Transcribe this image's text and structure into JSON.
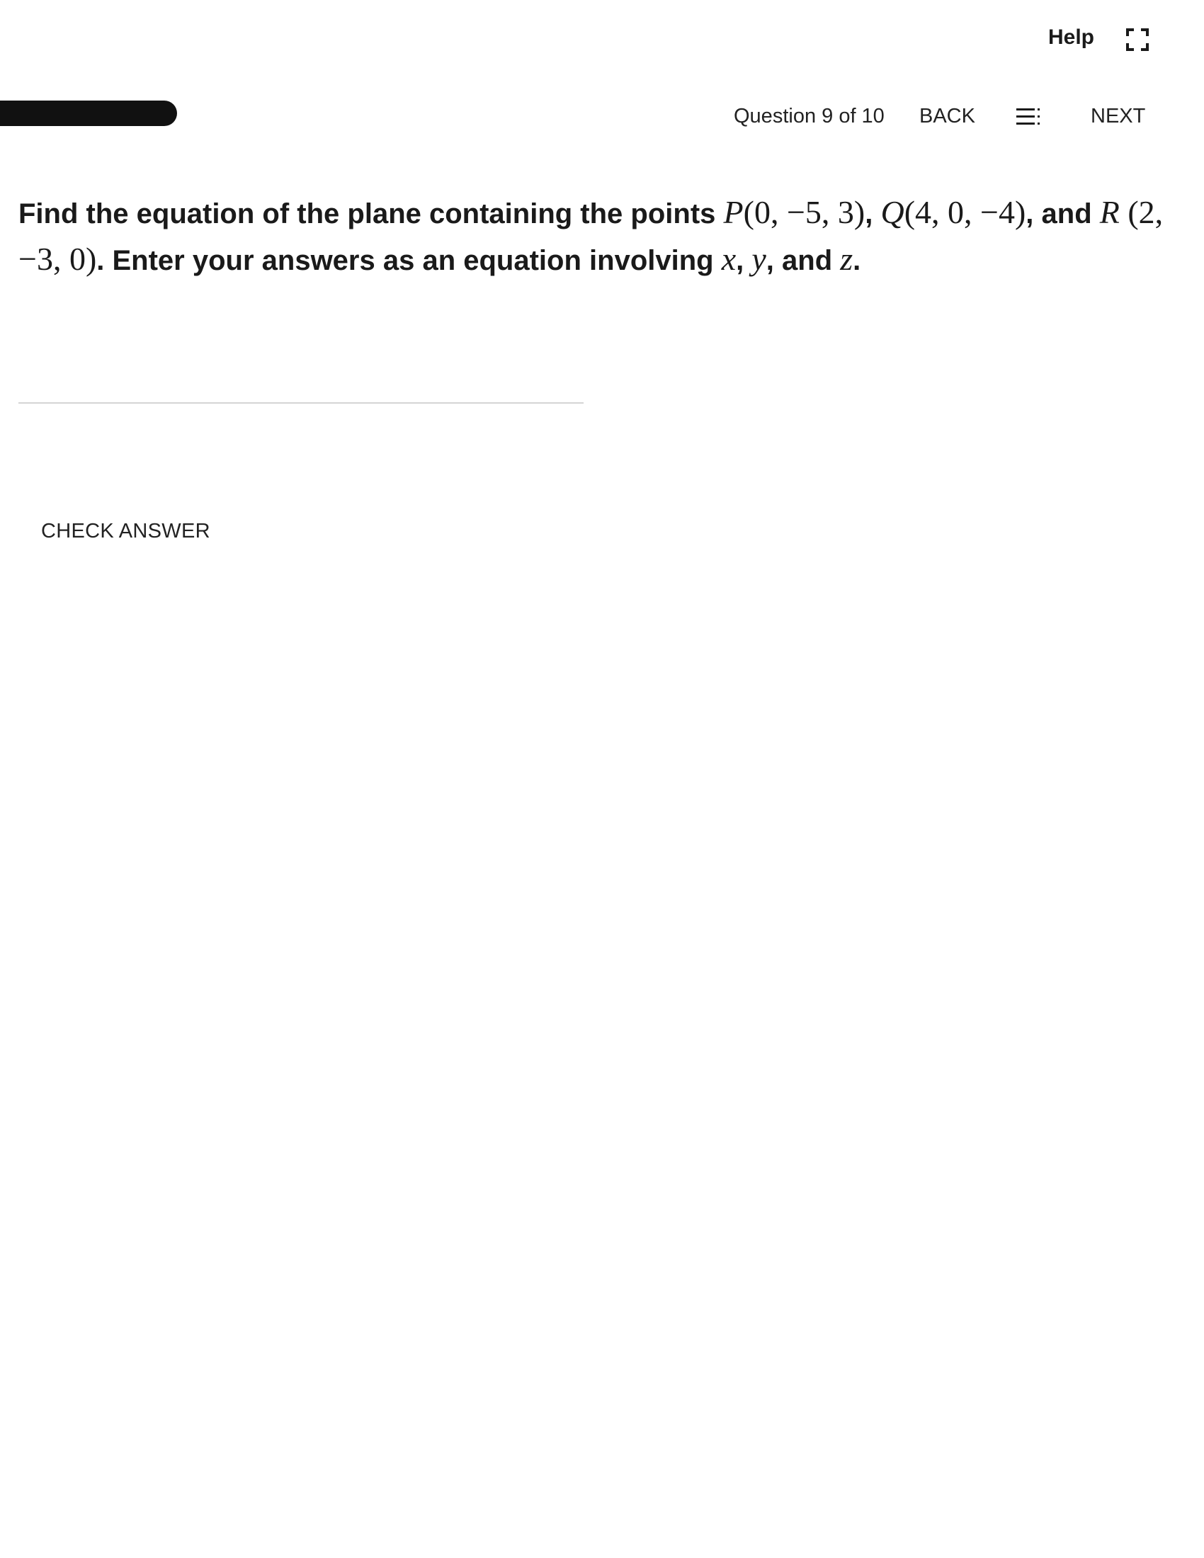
{
  "header": {
    "help_label": "Help"
  },
  "nav": {
    "question_counter": "Question 9 of 10",
    "back_label": "BACK",
    "next_label": "NEXT"
  },
  "question": {
    "lead": "Find the equation of the plane containing the points ",
    "p_name": "P",
    "p_coords": "(0, −5, 3)",
    "sep1": ", ",
    "q_name": "Q",
    "q_coords": "(4, 0, −4)",
    "sep2": ", and ",
    "r_name": "R",
    "r_coords": "(2, −3, 0)",
    "tail": ". Enter your answers as an equation involving ",
    "var_x": "x",
    "sep3": ", ",
    "var_y": "y",
    "sep4": ", and ",
    "var_z": "z",
    "end": "."
  },
  "answer": {
    "value": "",
    "placeholder": ""
  },
  "actions": {
    "check_answer_label": "CHECK ANSWER"
  },
  "icons": {
    "fullscreen": "fullscreen-icon",
    "menu": "question-list-icon"
  }
}
